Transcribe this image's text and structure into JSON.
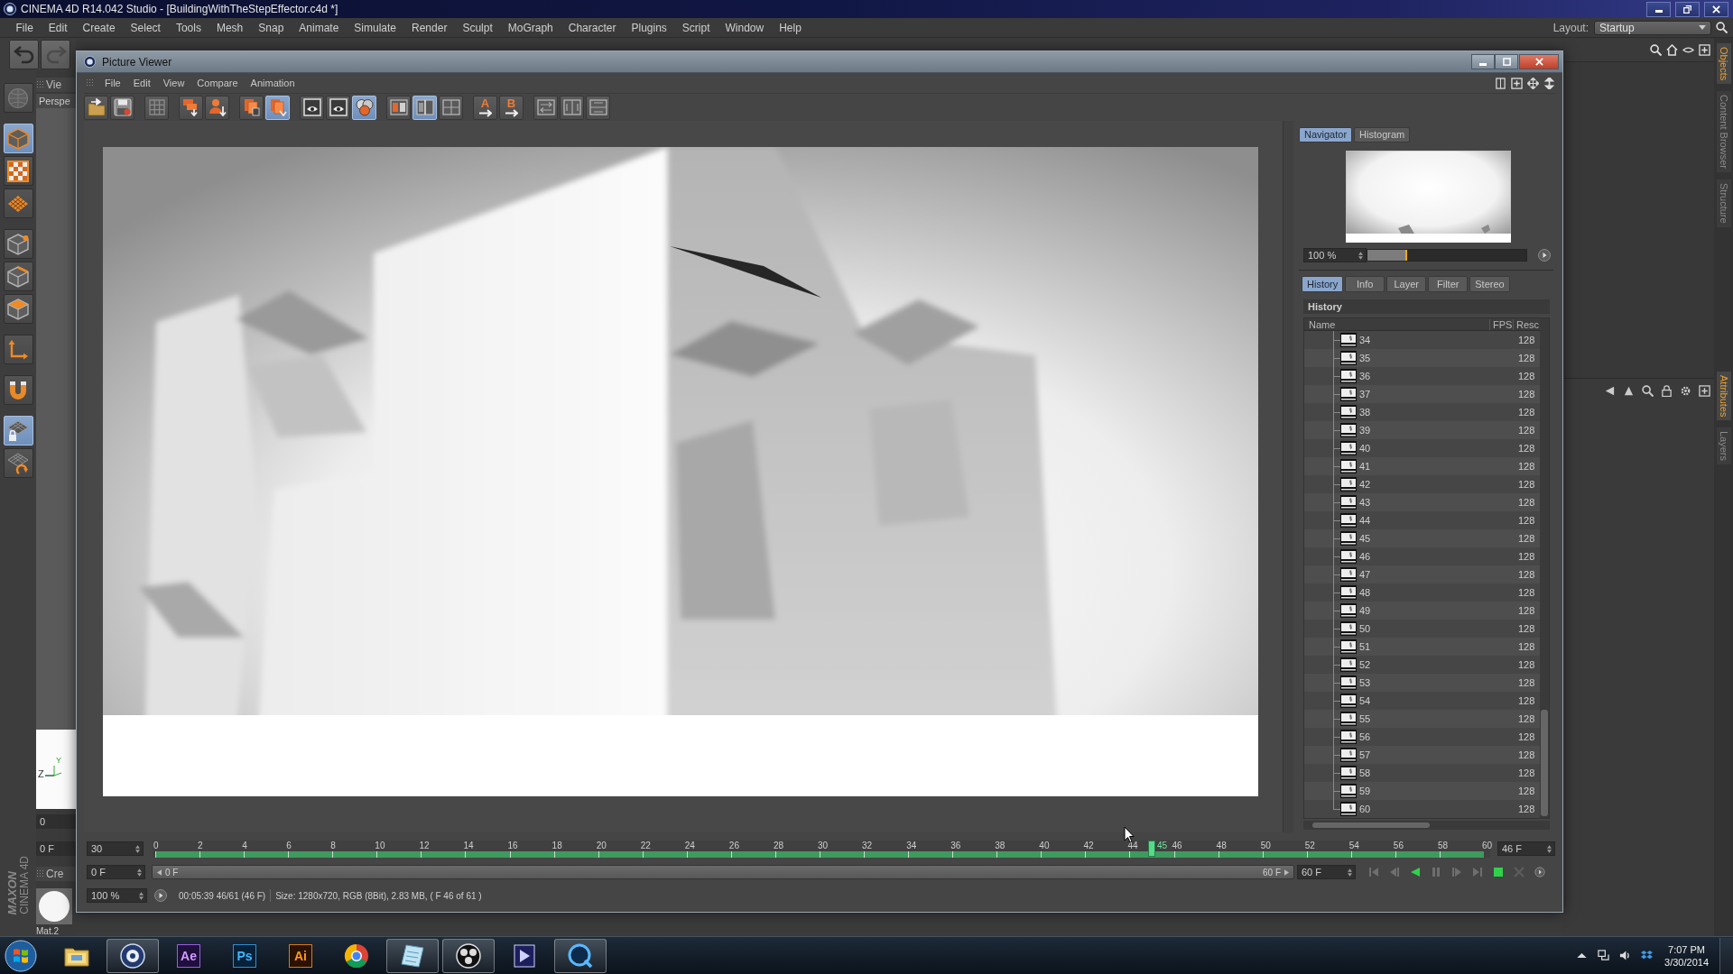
{
  "app_window": {
    "title": "CINEMA 4D R14.042 Studio - [BuildingWithTheStepEffector.c4d *]"
  },
  "menu_bar": {
    "items": [
      "File",
      "Edit",
      "Create",
      "Select",
      "Tools",
      "Mesh",
      "Snap",
      "Animate",
      "Simulate",
      "Render",
      "Sculpt",
      "MoGraph",
      "Character",
      "Plugins",
      "Script",
      "Window",
      "Help"
    ],
    "layout_label": "Layout:",
    "layout_value": "Startup"
  },
  "tool_palette": {
    "history_tools": [
      {
        "kind": "undo",
        "disabled": false
      },
      {
        "kind": "redo",
        "disabled": true
      }
    ],
    "tool_groups": [
      [
        {
          "kind": "sculpt",
          "selected": false,
          "disabled": true
        }
      ],
      [
        {
          "kind": "model",
          "selected": true,
          "disabled": false
        },
        {
          "kind": "texture",
          "selected": false,
          "disabled": false
        },
        {
          "kind": "workplane",
          "selected": false,
          "disabled": false
        }
      ],
      [
        {
          "kind": "points",
          "selected": false,
          "disabled": false
        },
        {
          "kind": "edges",
          "selected": false,
          "disabled": false
        },
        {
          "kind": "polygons",
          "selected": false,
          "disabled": false
        }
      ],
      [
        {
          "kind": "axis",
          "selected": false,
          "disabled": false
        }
      ],
      [
        {
          "kind": "snap",
          "selected": false,
          "disabled": false
        }
      ],
      [
        {
          "kind": "locked",
          "selected": true,
          "disabled": false
        },
        {
          "kind": "planar",
          "selected": false,
          "disabled": false
        }
      ]
    ]
  },
  "viewport": {
    "tab": "Vie",
    "camera": "Perspe",
    "axis_labels": [
      "Y",
      "Z"
    ],
    "frame_value": "0",
    "frame_field": "0 F",
    "material_tab": "Cre",
    "material_name": "Mat.2"
  },
  "logo": {
    "brand": "MAXON",
    "product": "CINEMA 4D"
  },
  "side_tabs": {
    "top": [
      {
        "label": "Objects",
        "selected": true
      },
      {
        "label": "Content Browser",
        "selected": false
      },
      {
        "label": "Structure",
        "selected": false
      }
    ],
    "bottom": [
      {
        "label": "Attributes",
        "selected": true
      },
      {
        "label": "Layers",
        "selected": false
      }
    ]
  },
  "picture_viewer": {
    "title": "Picture Viewer",
    "menu": [
      "File",
      "Edit",
      "View",
      "Compare",
      "Animation"
    ],
    "toolbar": [
      {
        "kind": "open",
        "selected": false
      },
      {
        "kind": "save",
        "selected": false
      },
      {
        "kind": "grid",
        "selected": false
      },
      {
        "kind": "stack-down",
        "selected": false
      },
      {
        "kind": "person-down",
        "selected": false
      },
      {
        "kind": "delete",
        "selected": false
      },
      {
        "kind": "copy",
        "selected": true
      },
      {
        "kind": "frame",
        "selected": false
      },
      {
        "kind": "frame",
        "selected": false
      },
      {
        "kind": "frame-group",
        "selected": true
      },
      {
        "kind": "compare",
        "selected": false
      },
      {
        "kind": "compare-split",
        "selected": true
      },
      {
        "kind": "compare-grid",
        "selected": false
      },
      {
        "kind": "set-a",
        "label": "A",
        "selected": false
      },
      {
        "kind": "set-b",
        "label": "B",
        "selected": false
      },
      {
        "kind": "swap",
        "selected": false
      },
      {
        "kind": "split-v",
        "selected": false
      },
      {
        "kind": "split-h",
        "selected": false
      }
    ],
    "navigator_tabs": [
      {
        "label": "Navigator",
        "selected": true
      },
      {
        "label": "Histogram",
        "selected": false
      }
    ],
    "zoom": {
      "value": "100 %",
      "level": 0.25
    },
    "panel_tabs": [
      {
        "label": "History",
        "selected": true
      },
      {
        "label": "Info",
        "selected": false
      },
      {
        "label": "Layer",
        "selected": false
      },
      {
        "label": "Filter",
        "selected": false
      },
      {
        "label": "Stereo",
        "selected": false
      }
    ],
    "history": {
      "title": "History",
      "columns": [
        "Name",
        "FPS",
        "Resc"
      ],
      "rows": [
        {
          "name": "34",
          "resolution": "128"
        },
        {
          "name": "35",
          "resolution": "128"
        },
        {
          "name": "36",
          "resolution": "128"
        },
        {
          "name": "37",
          "resolution": "128"
        },
        {
          "name": "38",
          "resolution": "128"
        },
        {
          "name": "39",
          "resolution": "128"
        },
        {
          "name": "40",
          "resolution": "128"
        },
        {
          "name": "41",
          "resolution": "128"
        },
        {
          "name": "42",
          "resolution": "128"
        },
        {
          "name": "43",
          "resolution": "128"
        },
        {
          "name": "44",
          "resolution": "128"
        },
        {
          "name": "45",
          "resolution": "128"
        },
        {
          "name": "46",
          "resolution": "128"
        },
        {
          "name": "47",
          "resolution": "128"
        },
        {
          "name": "48",
          "resolution": "128"
        },
        {
          "name": "49",
          "resolution": "128"
        },
        {
          "name": "50",
          "resolution": "128"
        },
        {
          "name": "51",
          "resolution": "128"
        },
        {
          "name": "52",
          "resolution": "128"
        },
        {
          "name": "53",
          "resolution": "128"
        },
        {
          "name": "54",
          "resolution": "128"
        },
        {
          "name": "55",
          "resolution": "128"
        },
        {
          "name": "56",
          "resolution": "128"
        },
        {
          "name": "57",
          "resolution": "128"
        },
        {
          "name": "58",
          "resolution": "128"
        },
        {
          "name": "59",
          "resolution": "128"
        },
        {
          "name": "60",
          "resolution": "128"
        }
      ]
    },
    "timeline": {
      "fps": "30",
      "ruler_labels": [
        "0",
        "2",
        "4",
        "6",
        "8",
        "10",
        "12",
        "14",
        "16",
        "18",
        "20",
        "22",
        "24",
        "26",
        "28",
        "30",
        "32",
        "34",
        "36",
        "38",
        "40",
        "42",
        "44",
        "46",
        "48",
        "50",
        "52",
        "54",
        "56",
        "58",
        "60"
      ],
      "playhead": {
        "label": "45",
        "level": 0.75
      },
      "current_frame": "46 F"
    },
    "range": {
      "start_field": "0 F",
      "bar_start": "0 F",
      "bar_end": "60 F",
      "end_field": "60 F"
    },
    "transport": [
      {
        "kind": "first"
      },
      {
        "kind": "prev"
      },
      {
        "kind": "play-reverse"
      },
      {
        "kind": "pause"
      },
      {
        "kind": "next"
      },
      {
        "kind": "last"
      },
      {
        "kind": "stop"
      },
      {
        "kind": "record"
      },
      {
        "kind": "options"
      }
    ],
    "status": {
      "zoom": "100 %",
      "timecode": "00:05:39 46/61 (46 F)",
      "info": "Size: 1280x720, RGB (8Bit), 2.83 MB, ( F 46 of 61 )"
    }
  },
  "taskbar": {
    "apps": [
      {
        "kind": "explorer",
        "running": false
      },
      {
        "kind": "cinema",
        "running": true
      },
      {
        "kind": "ae",
        "label": "Ae",
        "running": false
      },
      {
        "kind": "ps",
        "label": "Ps",
        "running": false
      },
      {
        "kind": "ai",
        "label": "Ai",
        "running": false
      },
      {
        "kind": "chrome",
        "running": false
      },
      {
        "kind": "notes",
        "running": true
      },
      {
        "kind": "obs",
        "running": true
      },
      {
        "kind": "media",
        "running": false
      },
      {
        "kind": "quicktime",
        "running": true
      }
    ],
    "time": "7:07 PM",
    "date": "3/30/2014"
  }
}
